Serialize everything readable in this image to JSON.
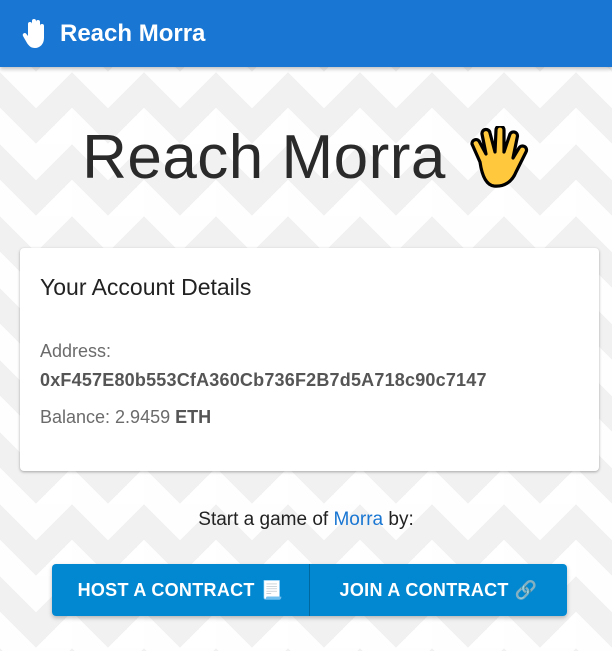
{
  "appbar": {
    "title": "Reach Morra",
    "icon": "raised-hand-icon"
  },
  "hero": {
    "title": "Reach Morra",
    "icon": "raised-hand-fingers-splayed-icon"
  },
  "account": {
    "title": "Your Account Details",
    "address_label": "Address:",
    "address": "0xF457E80b553CfA360Cb736F2B7d5A718c90c7147",
    "balance_label": "Balance: 2.9459",
    "balance_unit": "ETH"
  },
  "prompt": {
    "before": "Start a game of ",
    "link": "Morra",
    "after": " by:"
  },
  "actions": {
    "host_label": "HOST A CONTRACT",
    "host_emoji": "📃",
    "join_label": "JOIN A CONTRACT",
    "join_emoji": "🔗"
  },
  "colors": {
    "primary": "#1976d2",
    "button": "#0288d1"
  }
}
